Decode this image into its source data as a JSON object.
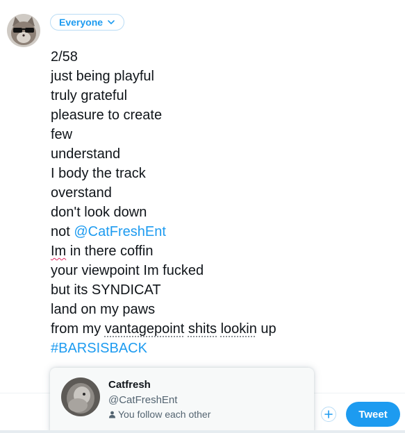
{
  "composer": {
    "audience_label": "Everyone",
    "lines": [
      "2/58",
      "just being playful",
      "truly grateful",
      "pleasure to create",
      "few",
      "understand",
      "I body the track",
      "overstand",
      "don't look down",
      {
        "prefix": "not ",
        "mention": "@CatFreshEnt"
      },
      {
        "spell": "Im",
        "rest": " in there coffin"
      },
      "your viewpoint Im fucked",
      "but its SYNDICAT",
      "land on my paws",
      {
        "a": "from my ",
        "b": "vantagepoint",
        "c": " ",
        "d": "shits",
        "e": " ",
        "f": "lookin",
        "g": " up"
      },
      {
        "hashtag": "#BARSISBACK"
      }
    ]
  },
  "hovercard": {
    "name": "Catfresh",
    "handle": "@CatFreshEnt",
    "follow_status": "You follow each other"
  },
  "toolbar": {
    "tweet_label": "Tweet"
  },
  "colors": {
    "accent": "#1d9bf0",
    "text": "#0f1419",
    "muted": "#536471"
  }
}
